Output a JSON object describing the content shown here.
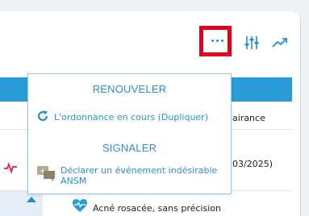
{
  "toolbar": {
    "more_icon": "more-horizontal-icon",
    "filter_icon": "sliders-icon",
    "trend_icon": "trending-up-icon",
    "accent": "#1f8ed8",
    "highlight": "#e3001b"
  },
  "popup": {
    "renew_title": "RENOUVELER",
    "renew_item": "L'ordonnance en cours (Dupliquer)",
    "report_title": "SIGNALER",
    "report_item_line1": "Déclarer un événement indésirable",
    "report_item_line2": "ANSM"
  },
  "background": {
    "text_row1": "airance",
    "text_row2": "03/2025)",
    "diagnosis": "Acné rosacée, sans précision"
  }
}
